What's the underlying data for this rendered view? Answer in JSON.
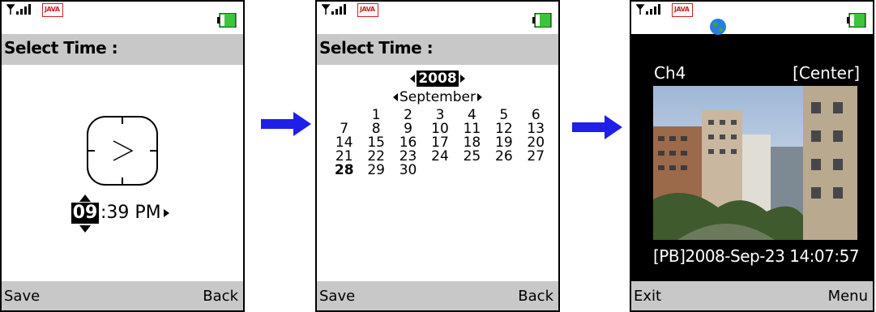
{
  "screens": [
    {
      "title": "Select Time :",
      "time": {
        "hour": "09",
        "rest": ":39 PM"
      },
      "soft_left": "Save",
      "soft_right": "Back"
    },
    {
      "title": "Select Time :",
      "year": "2008",
      "month": "September",
      "calendar_rows": [
        [
          "",
          "1",
          "2",
          "3",
          "4",
          "5",
          "6"
        ],
        [
          "7",
          "8",
          "9",
          "10",
          "11",
          "12",
          "13"
        ],
        [
          "14",
          "15",
          "16",
          "17",
          "18",
          "19",
          "20"
        ],
        [
          "21",
          "22",
          "23",
          "24",
          "25",
          "26",
          "27"
        ],
        [
          "28",
          "29",
          "30",
          "",
          "",
          "",
          ""
        ]
      ],
      "selected_day": "28",
      "soft_left": "Save",
      "soft_right": "Back"
    },
    {
      "channel": "Ch4",
      "position": "[Center]",
      "playback": "[PB]2008-Sep-23 14:07:57",
      "soft_left": "Exit",
      "soft_right": "Menu"
    }
  ],
  "status_icons": [
    "signal-icon",
    "java-icon",
    "battery-icon",
    "globe-icon"
  ],
  "java_text": "JAVA",
  "colors": {
    "bar": "#c8c8c8",
    "arrow": "#1f1fe8",
    "battery": "#3cc43c",
    "java": "#cc2222"
  }
}
